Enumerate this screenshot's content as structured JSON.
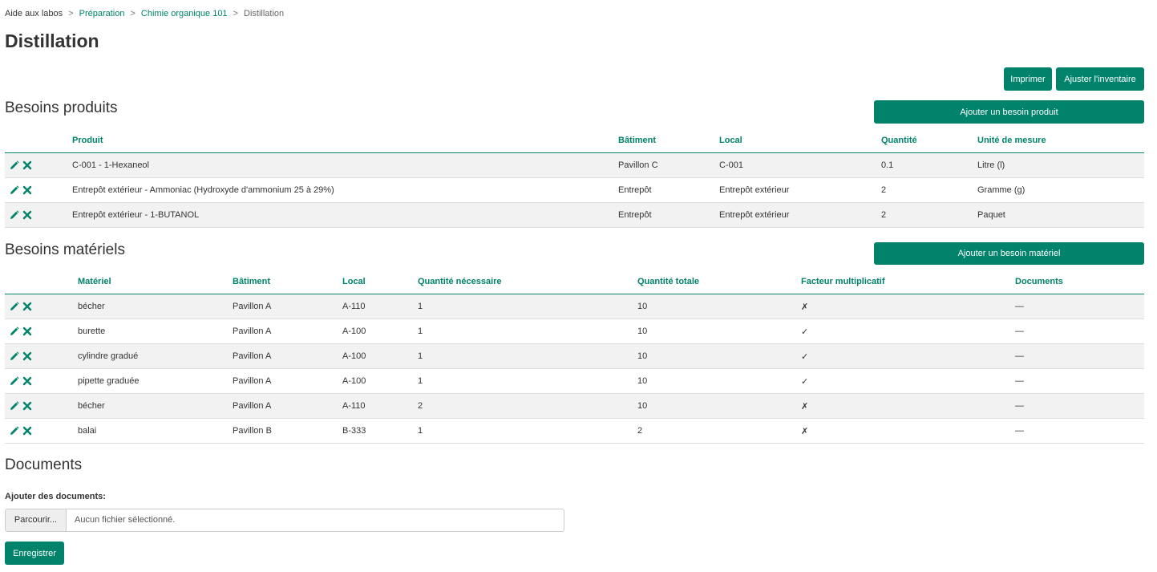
{
  "breadcrumb": {
    "items": [
      "Aide aux labos",
      "Préparation",
      "Chimie organique 101",
      "Distillation"
    ],
    "separator": ">"
  },
  "page": {
    "title": "Distillation"
  },
  "toolbar": {
    "print_label": "Imprimer",
    "adjust_label": "Ajuster l'inventaire"
  },
  "produits": {
    "title": "Besoins produits",
    "add_label": "Ajouter un besoin produit",
    "headers": [
      "Produit",
      "Bâtiment",
      "Local",
      "Quantité",
      "Unité de mesure"
    ],
    "rows": [
      [
        "C-001 - 1-Hexaneol",
        "Pavillon C",
        "C-001",
        "0.1",
        "Litre (l)"
      ],
      [
        "Entrepôt extérieur - Ammoniac (Hydroxyde d'ammonium 25 à 29%)",
        "Entrepôt",
        "Entrepôt extérieur",
        "2",
        "Gramme (g)"
      ],
      [
        "Entrepôt extérieur - 1-BUTANOL",
        "Entrepôt",
        "Entrepôt extérieur",
        "2",
        "Paquet"
      ]
    ]
  },
  "materiels": {
    "title": "Besoins matériels",
    "add_label": "Ajouter un besoin matériel",
    "headers": [
      "Matériel",
      "Bâtiment",
      "Local",
      "Quantité nécessaire",
      "Quantité totale",
      "Facteur multiplicatif",
      "Documents"
    ],
    "rows": [
      [
        "bécher",
        "Pavillon A",
        "A-110",
        "1",
        "10",
        "✗",
        "—"
      ],
      [
        "burette",
        "Pavillon A",
        "A-100",
        "1",
        "10",
        "✓",
        "—"
      ],
      [
        "cylindre gradué",
        "Pavillon A",
        "A-100",
        "1",
        "10",
        "✓",
        "—"
      ],
      [
        "pipette graduée",
        "Pavillon A",
        "A-100",
        "1",
        "10",
        "✓",
        "—"
      ],
      [
        "bécher",
        "Pavillon A",
        "A-110",
        "2",
        "10",
        "✗",
        "—"
      ],
      [
        "balai",
        "Pavillon B",
        "B-333",
        "1",
        "2",
        "✗",
        "—"
      ]
    ]
  },
  "documents": {
    "title": "Documents",
    "add_label": "Ajouter des documents:",
    "browse_label": "Parcourir...",
    "file_status": "Aucun fichier sélectionné.",
    "save_label": "Enregistrer"
  },
  "colors": {
    "accent": "#00826b",
    "stripe": "#f2f2f2",
    "text": "#333333"
  },
  "icons": {
    "edit": "pencil-icon",
    "delete": "close-icon"
  }
}
